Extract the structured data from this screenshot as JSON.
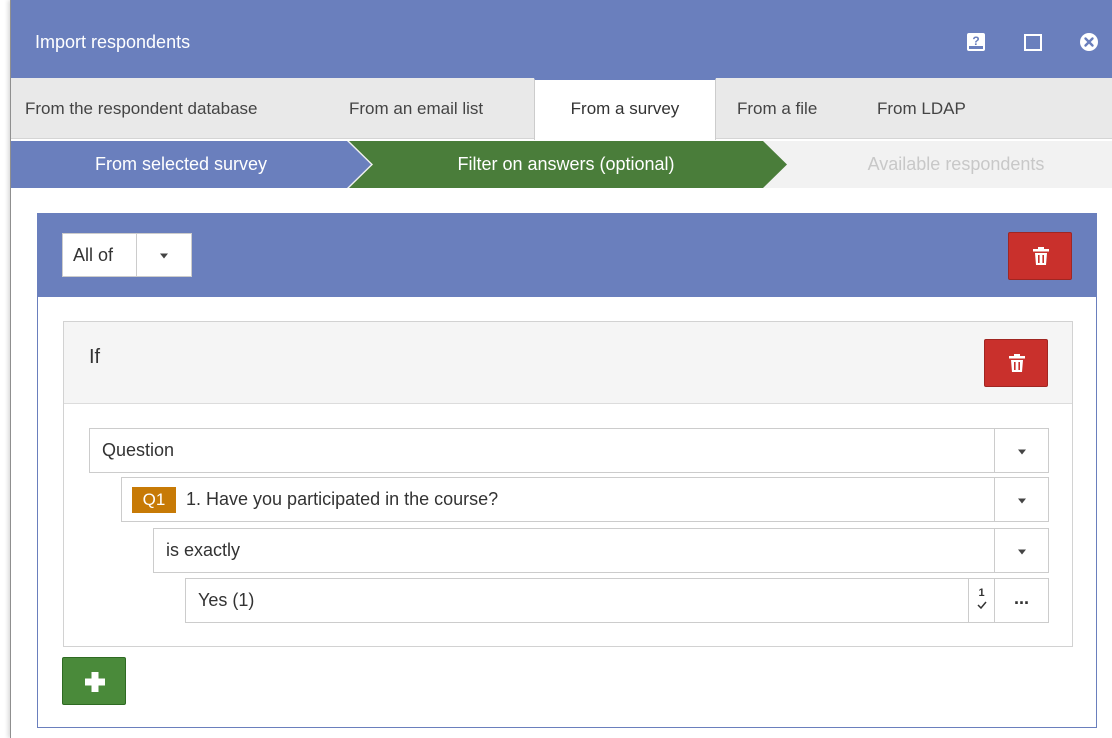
{
  "window": {
    "title": "Import respondents",
    "icons": [
      "help-icon",
      "maximize-icon",
      "close-icon"
    ]
  },
  "tabs": [
    {
      "label": "From the respondent database",
      "active": false
    },
    {
      "label": "From an email list",
      "active": false
    },
    {
      "label": "From a survey",
      "active": true
    },
    {
      "label": "From a file",
      "active": false
    },
    {
      "label": "From LDAP",
      "active": false
    }
  ],
  "steps": [
    {
      "label": "From selected survey",
      "state": "done"
    },
    {
      "label": "Filter on answers (optional)",
      "state": "current"
    },
    {
      "label": "Available respondents",
      "state": "disabled"
    }
  ],
  "filter": {
    "group_mode": "All of",
    "condition": {
      "label": "If",
      "type_field": "Question",
      "question_badge": "Q1",
      "question_text": "1. Have you participated in the course?",
      "operator": "is exactly",
      "value": "Yes (1)",
      "value_indicator": "1",
      "more_label": "..."
    }
  },
  "colors": {
    "primary": "#6a7fbd",
    "step_current": "#4a7d3a",
    "danger": "#c9302c",
    "success": "#4a8a3a",
    "badge": "#c77a06"
  }
}
